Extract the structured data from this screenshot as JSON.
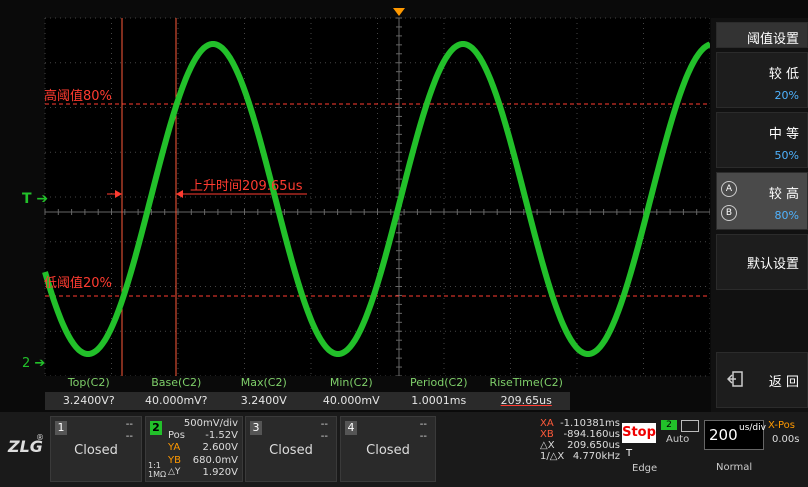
{
  "chart_data": {
    "type": "line",
    "title": "",
    "series": [
      {
        "name": "C2",
        "values": []
      }
    ],
    "channel_marker": "T",
    "channel2_marker": "2",
    "cursor_label": "上升时间209.65us",
    "high_threshold_label": "高阈值80%",
    "low_threshold_label": "低阈值20%"
  },
  "measurements": [
    {
      "name": "Top(C2)",
      "value": "3.2400V?"
    },
    {
      "name": "Base(C2)",
      "value": "40.000mV?"
    },
    {
      "name": "Max(C2)",
      "value": "3.2400V"
    },
    {
      "name": "Min(C2)",
      "value": "40.000mV"
    },
    {
      "name": "Period(C2)",
      "value": "1.0001ms"
    },
    {
      "name": "RiseTime(C2)",
      "value": "209.65us"
    }
  ],
  "right_panel": {
    "title": "阈值设置",
    "buttons": [
      {
        "label": "较 低",
        "value": "20%"
      },
      {
        "label": "中 等",
        "value": "50%"
      },
      {
        "label": "较 高",
        "value": "80%"
      },
      {
        "label": "默认设置",
        "value": ""
      },
      {
        "label": "返 回",
        "value": ""
      }
    ]
  },
  "channels": [
    {
      "num": "1",
      "state": "Closed",
      "dash1": "--",
      "dash2": "--"
    },
    {
      "num": "3",
      "state": "Closed",
      "dash1": "--",
      "dash2": "--"
    },
    {
      "num": "4",
      "state": "Closed",
      "dash1": "--",
      "dash2": "--"
    }
  ],
  "ch2": {
    "num": "2",
    "scale": "500mV/div",
    "pos_label": "Pos",
    "pos": "-1.52V",
    "ya_label": "YA",
    "ya": "2.600V",
    "yb_label": "YB",
    "yb": "680.0mV",
    "dy_label": "△Y",
    "dy": "1.920V",
    "coupling": "1:1",
    "impedance": "1MΩ"
  },
  "cursors": {
    "xa_label": "XA",
    "xa": "-1.10381ms",
    "xb_label": "XB",
    "xb": "-894.160us",
    "dx_label": "△X",
    "dx": "209.650us",
    "inv_label": "1/△X",
    "inv": "4.770kHz"
  },
  "acq": {
    "state": "Stop",
    "trigger_src": "T",
    "auto_label": "Auto",
    "ch": "2",
    "edge": "Edge",
    "timebase_value": "200",
    "timebase_unit": "us/div",
    "xpos_label": "X-Pos",
    "xpos": "0.00s",
    "mode": "Normal"
  },
  "colors": {
    "trace": "#22c02a",
    "threshold": "#ff3b30",
    "accent_blue": "#4fb3ff",
    "trigger": "#ff9900"
  }
}
